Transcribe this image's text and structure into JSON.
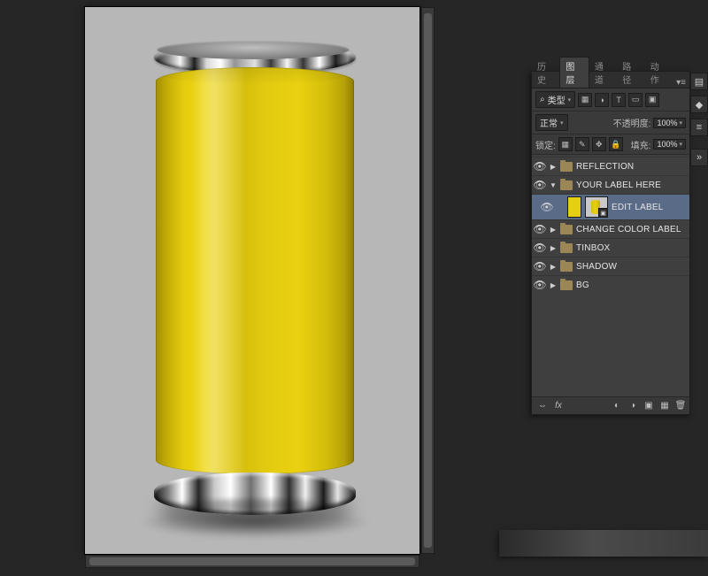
{
  "panel": {
    "tabs": {
      "history": "历史",
      "layers": "图层",
      "channels": "通道",
      "paths": "路径",
      "actions": "动作"
    },
    "filter": {
      "kind_label": "类型",
      "blend_mode": "正常",
      "opacity_label": "不透明度:",
      "opacity_value": "100%",
      "lock_label": "锁定:",
      "fill_label": "填充:",
      "fill_value": "100%"
    },
    "filterbtns": {
      "img": "▦",
      "adj": "◑",
      "txt": "T",
      "shape": "▭",
      "smart": "▣"
    },
    "lockbtns": {
      "trans": "▦",
      "paint": "✎",
      "move": "✥",
      "all": "🔒"
    },
    "layers": {
      "reflection": "REFLECTION",
      "your_label_here": "YOUR LABEL HERE",
      "edit_label": "EDIT LABEL",
      "change_color_label": "CHANGE COLOR LABEL",
      "tinbox": "TINBOX",
      "shadow": "SHADOW",
      "bg": "BG"
    },
    "footer": {
      "link": "⇔",
      "fx": "fx",
      "mask": "◐",
      "adj": "◑",
      "group": "▣",
      "new": "▦",
      "trash": "🗑"
    }
  },
  "iconstrip": {
    "props": "▤",
    "swatch": "◆",
    "pp": "≡",
    "collapse": "»"
  }
}
